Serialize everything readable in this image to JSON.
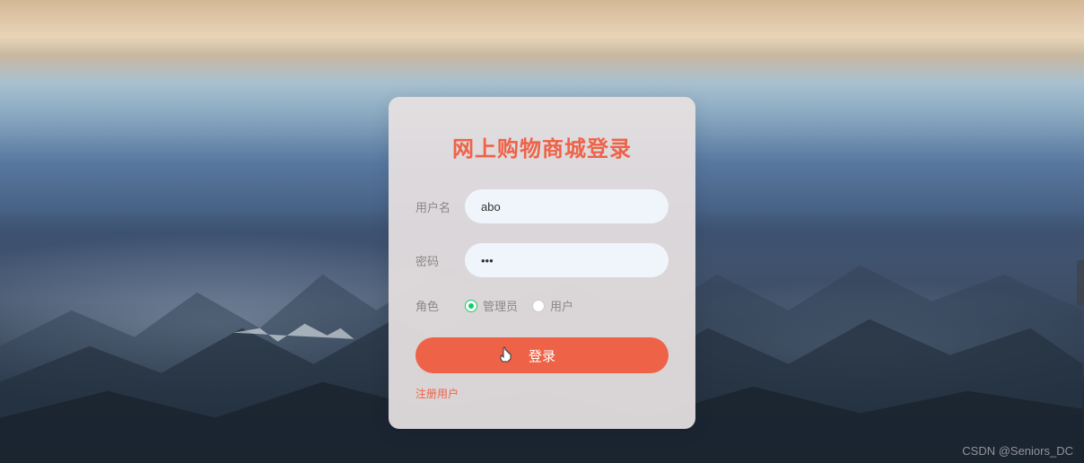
{
  "login": {
    "title": "网上购物商城登录",
    "username_label": "用户名",
    "username_value": "abo",
    "password_label": "密码",
    "password_value": "•••",
    "role_label": "角色",
    "role_options": {
      "admin": "管理员",
      "user": "用户"
    },
    "role_selected": "admin",
    "submit_button": "登录",
    "register_link": "注册用户"
  },
  "watermark": "CSDN @Seniors_DC",
  "colors": {
    "accent": "#ee6347",
    "radio_active": "#13ce66"
  }
}
